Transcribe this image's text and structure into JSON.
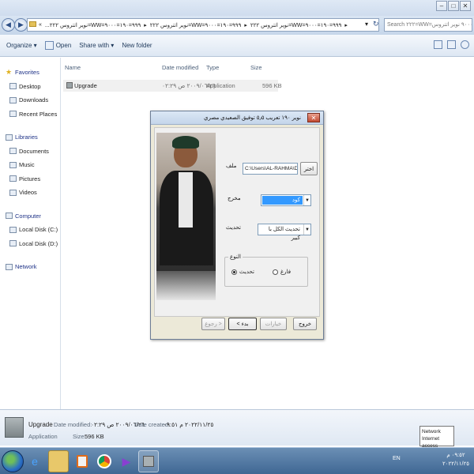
{
  "window": {
    "minimize": "–",
    "maximize": "□",
    "close": "✕"
  },
  "nav": {
    "back_icon": "arrow-left-icon",
    "forward_icon": "arrow-right-icon"
  },
  "address": {
    "segments": [
      "«",
      "...نوير اتتروس ٢٢٢=WW=٩٩٩=١٩٠=٩٠٠٠",
      "▸",
      "نوير اتتروس ٢٢٢=WW=٩٩٩=١٩٠=٩٠٠٠",
      "▸",
      "نوير اتتروس ٢٢٢=WW=٩٩٩=١٩٠=٩٠٠٠",
      "▸"
    ],
    "refresh": "↻",
    "dropdown": "▾"
  },
  "search": {
    "placeholder": "Search ٢٢٢=WW=٩٩٩=١٩٠=٩٠٠٠ نوير اتتروس"
  },
  "toolbar": {
    "organize": "Organize ▾",
    "open": "Open",
    "share_with": "Share with ▾",
    "new_folder": "New folder"
  },
  "sidebar": {
    "favorites": {
      "label": "Favorites",
      "items": [
        "Desktop",
        "Downloads",
        "Recent Places"
      ]
    },
    "libraries": {
      "label": "Libraries",
      "items": [
        "Documents",
        "Music",
        "Pictures",
        "Videos"
      ]
    },
    "computer": {
      "label": "Computer",
      "items": [
        "Local Disk (C:)",
        "Local Disk (D:)"
      ]
    },
    "network": {
      "label": "Network"
    }
  },
  "columns": {
    "name": "Name",
    "date_modified": "Date modified",
    "type": "Type",
    "size": "Size"
  },
  "files": [
    {
      "name": "Upgrade",
      "date_modified": "٢٠٠٩/٠٦/٢٦ ص ٠٢:٢٩",
      "type": "Application",
      "size": "596 KB"
    }
  ],
  "dialog": {
    "title": "نوير ١٩٠ تعريب ٥٫٥ توفيق الصعيدي مصري",
    "close": "✕",
    "file_label": "ملف",
    "file_path": "C:\\Users\\AL-RAHMA\\Deskto",
    "browse_button": "اختر",
    "output_label": "مخرج",
    "output_value": "كود",
    "update_label": "تحديث",
    "update_value": "تحديث الكل با كبير",
    "type_group": "النوع",
    "radio_update": "تحديث",
    "radio_empty": "فارغ",
    "back_button": "رجوع >",
    "start_button": "< بدء",
    "options_button": "خيارات",
    "exit_button": "خروج"
  },
  "details": {
    "name": "Upgrade",
    "type": "Application",
    "date_modified_label": "Date modified:",
    "date_modified": "٢٠٠٩/٠٦/٢٦ ص ٠٢:٢٩",
    "size_label": "Size:",
    "size": "596 KB",
    "date_created_label": "Date created:",
    "date_created": "٢٠٢٢/١١/٢٥ م ٠٩:٥١"
  },
  "tooltip": {
    "line1": "Network",
    "line2": "Internet access"
  },
  "taskbar": {
    "lang": "EN",
    "time": "٠٩:٥٢ م",
    "date": "٢٠٢٢/١١/٢٥"
  }
}
